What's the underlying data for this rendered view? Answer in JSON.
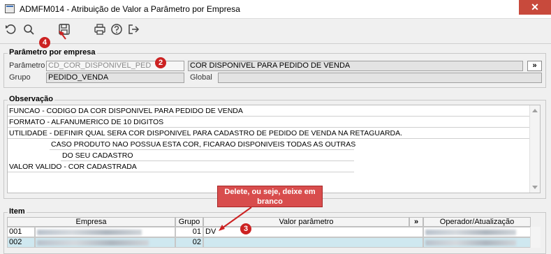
{
  "window": {
    "title": "ADMFM014 - Atribuição de Valor a Parâmetro por Empresa",
    "close_label": "✕"
  },
  "toolbar": {
    "undo_icon": "undo-icon",
    "search_icon": "search-icon",
    "save_icon": "save-icon",
    "print_icon": "print-icon",
    "help_icon": "help-icon",
    "exit_icon": "exit-icon"
  },
  "param_group": {
    "title": "Parâmetro por empresa",
    "param_label": "Parâmetro",
    "param_value": "CD_COR_DISPONIVEL_PED",
    "param_desc": "COR DISPONIVEL PARA PEDIDO DE VENDA",
    "more_btn": "»",
    "grupo_label": "Grupo",
    "grupo_value": "PEDIDO_VENDA",
    "global_label": "Global",
    "global_value": ""
  },
  "obs_group": {
    "title": "Observação",
    "lines": [
      "FUNCAO - CODIGO DA COR DISPONIVEL PARA PEDIDO DE VENDA",
      "FORMATO - ALFANUMERICO DE 10 DIGITOS",
      "UTILIDADE - DEFINIR QUAL SERA COR DISPONIVEL PARA CADASTRO DE PEDIDO DE VENDA NA RETAGUARDA.",
      "CASO PRODUTO NAO POSSUA ESTA COR, FICARAO DISPONIVEIS TODAS AS OUTRAS",
      "DO SEU CADASTRO",
      "VALOR VALIDO - COR CADASTRADA"
    ]
  },
  "item_group": {
    "title": "Item",
    "columns": {
      "empresa": "Empresa",
      "grupo": "Grupo",
      "valor": "Valor parâmetro",
      "more": "»",
      "operador": "Operador/Atualização"
    },
    "rows": [
      {
        "code": "001",
        "grupo": "01",
        "valor": "DV"
      },
      {
        "code": "002",
        "grupo": "02",
        "valor": ""
      }
    ]
  },
  "annotations": {
    "badge_2": "2",
    "badge_3": "3",
    "badge_4": "4",
    "callout_text": "Delete, ou seje, deixe em branco"
  },
  "colors": {
    "badge": "#cc2222",
    "callout": "#d84d4d",
    "selected_row": "#cfe8f0"
  }
}
